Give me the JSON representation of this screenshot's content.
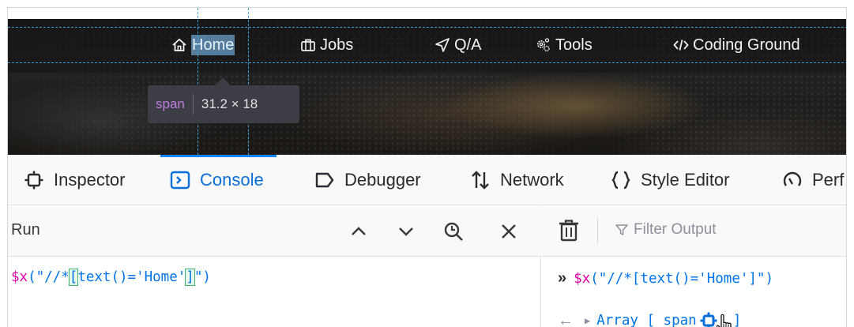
{
  "site": {
    "nav": {
      "home": "Home",
      "jobs": "Jobs",
      "qa": "Q/A",
      "tools": "Tools",
      "coding": "Coding Ground"
    },
    "tooltip": {
      "tag": "span",
      "dims": "31.2 × 18"
    }
  },
  "devtools": {
    "tabs": {
      "inspector": "Inspector",
      "console": "Console",
      "debugger": "Debugger",
      "network": "Network",
      "style_editor": "Style Editor",
      "performance": "Perf"
    },
    "active_tab": "Console",
    "accent": "#0a84ff",
    "editor": {
      "run_label": "Run",
      "input": {
        "dollar": "$x",
        "pre": "(\"//*",
        "open": "[",
        "mid": "text()='Home'",
        "close": "]",
        "post": "\")"
      }
    },
    "output": {
      "filter_placeholder": "Filter Output",
      "echo": {
        "prompt": "»",
        "dollar": "$x",
        "rest": "(\"//*[text()='Home']\")"
      },
      "result": {
        "arrow": "←",
        "type": "Array",
        "open": "[",
        "tag": "span",
        "close": "]"
      }
    }
  }
}
